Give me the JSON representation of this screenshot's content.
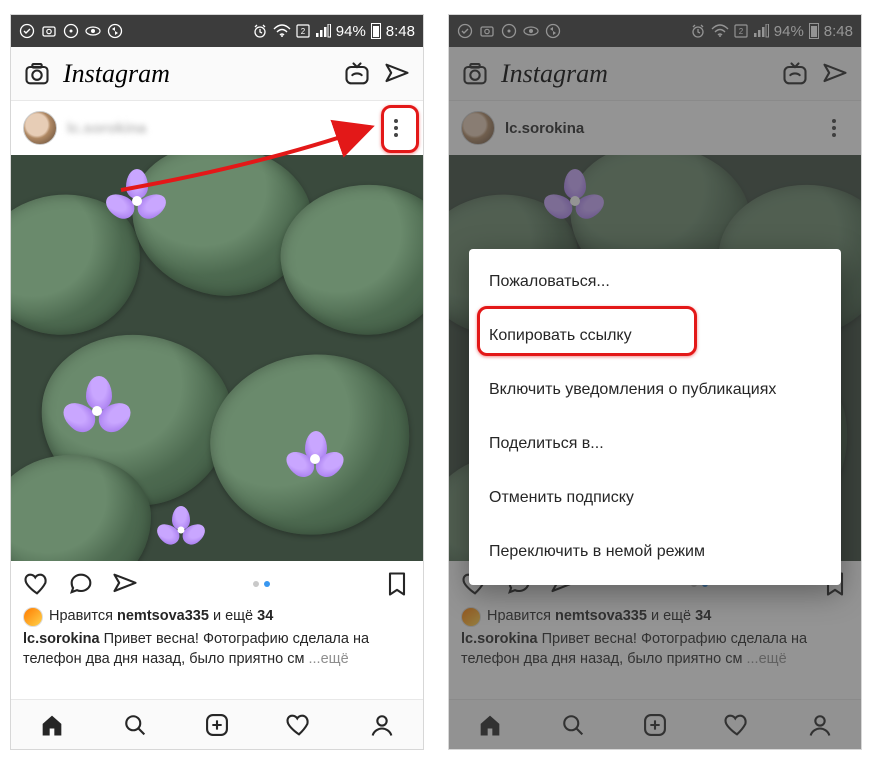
{
  "status": {
    "battery": "94%",
    "time": "8:48"
  },
  "brand": "Instagram",
  "left": {
    "username": "lc.sorokina",
    "usernameBlurred": true,
    "likes": {
      "prefix": "Нравится",
      "who": "nemtsova335",
      "and": "и ещё",
      "count": "34"
    },
    "caption": {
      "author": "lc.sorokina",
      "text": "Привет весна! Фотографию сделала на телефон два дня назад, было приятно см",
      "more": "...ещё"
    }
  },
  "right": {
    "username": "lc.sorokina",
    "likes": {
      "prefix": "Нравится",
      "who": "nemtsova335",
      "and": "и ещё",
      "count": "34"
    },
    "caption": {
      "author": "lc.sorokina",
      "text": "Привет весна! Фотографию сделала на телефон два дня назад, было приятно см",
      "more": "...ещё"
    },
    "menu": [
      "Пожаловаться...",
      "Копировать ссылку",
      "Включить уведомления о публикациях",
      "Поделиться в...",
      "Отменить подписку",
      "Переключить в немой режим"
    ]
  }
}
